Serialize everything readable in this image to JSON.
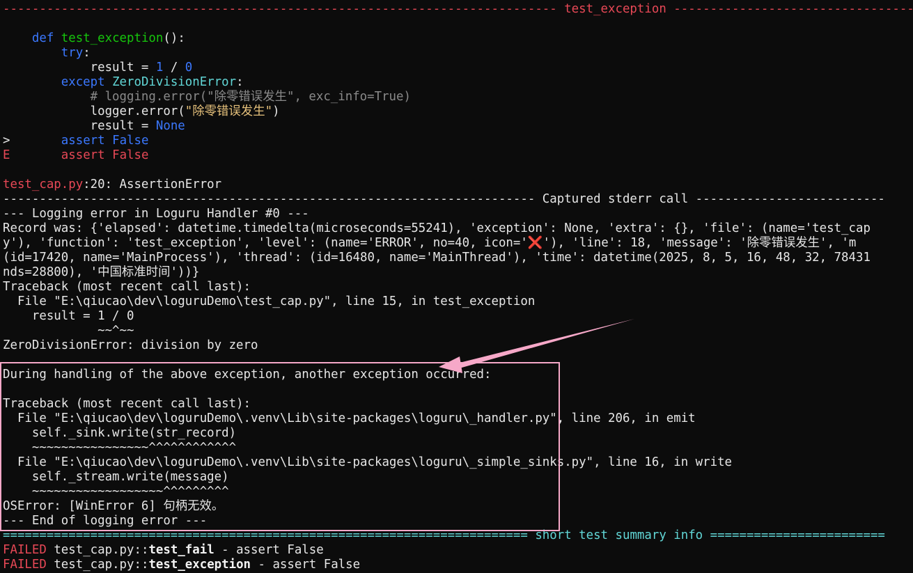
{
  "banner": {
    "left": "---------------------------------------------------------------------------- ",
    "title": "test_exception",
    "right": " -----------------------------------------"
  },
  "code": {
    "l1": {
      "indent": "    ",
      "kw": "def",
      "sp": " ",
      "fn": "test_exception",
      "rest": "():"
    },
    "l2": {
      "indent": "        ",
      "kw": "try",
      "rest": ":"
    },
    "l3": {
      "indent": "            ",
      "a": "result = ",
      "n1": "1",
      "op": " / ",
      "n2": "0"
    },
    "l4": {
      "indent": "        ",
      "kw": "except",
      "sp": " ",
      "cls": "ZeroDivisionError",
      "rest": ":"
    },
    "l5": {
      "indent": "            ",
      "text": "# logging.error(\"除零错误发生\", exc_info=True)"
    },
    "l6": {
      "indent": "            ",
      "a": "logger.error(",
      "str": "\"除零错误发生\"",
      "b": ")"
    },
    "l7": {
      "indent": "            ",
      "a": "result = ",
      "kw": "None"
    },
    "l8": {
      "prefix": ">",
      "indent": "       ",
      "kw": "assert",
      "sp": " ",
      "val": "False"
    },
    "l9": {
      "prefix": "E",
      "indent": "       ",
      "kw": "assert",
      "sp": " ",
      "val": "False"
    }
  },
  "location": {
    "file": "test_cap.py",
    "rest": ":20: AssertionError"
  },
  "stderr_banner": {
    "left": "------------------------------------------------------------------------- ",
    "title": "Captured stderr call",
    "right": " --------------------------"
  },
  "stderr_lines": [
    "--- Logging error in Loguru Handler #0 ---",
    "Record was: {'elapsed': datetime.timedelta(microseconds=55241), 'exception': None, 'extra': {}, 'file': (name='test_cap",
    "y'), 'function': 'test_exception', 'level': (name='ERROR', no=40, icon='",
    "(id=17420, name='MainProcess'), 'thread': (id=16480, name='MainThread'), 'time': datetime(2025, 8, 5, 16, 48, 32, 78431",
    "nds=28800), '中国标准时间'))}",
    "Traceback (most recent call last):",
    "  File \"E:\\qiucao\\dev\\loguruDemo\\test_cap.py\", line 15, in test_exception",
    "    result = 1 / 0",
    "             ~~^~~",
    "ZeroDivisionError: division by zero",
    "",
    "During handling of the above exception, another exception occurred:",
    "",
    "Traceback (most recent call last):",
    "  File \"E:\\qiucao\\dev\\loguruDemo\\.venv\\Lib\\site-packages\\loguru\\_handler.py\", line 206, in emit",
    "    self._sink.write(str_record)",
    "    ~~~~~~~~~~~~~~~~^^^^^^^^^^^^",
    "  File \"E:\\qiucao\\dev\\loguruDemo\\.venv\\Lib\\site-packages\\loguru\\_simple_sinks.py\", line 16, in write",
    "    self._stream.write(message)",
    "    ~~~~~~~~~~~~~~~~~~^^^^^^^^^",
    "OSError: [WinError 6] 句柄无效。",
    "--- End of logging error ---"
  ],
  "stderr_line3_icon": "❌",
  "stderr_line3_rest": "'), 'line': 18, 'message': '除零错误发生', 'm",
  "summary_banner": {
    "left": "======================================================================== ",
    "title": "short test summary info",
    "right": " ========================"
  },
  "summary": [
    {
      "status": "FAILED",
      "sep": " ",
      "file": "test_cap.py::",
      "test": "test_fail",
      "msg": " - assert False"
    },
    {
      "status": "FAILED",
      "sep": " ",
      "file": "test_cap.py::",
      "test": "test_exception",
      "msg": " - assert False"
    }
  ],
  "colors": {
    "background": "#0c0c0c",
    "error_red": "#e74856",
    "keyword_blue": "#3b78ff",
    "function_green": "#16c60c",
    "banner_cyan": "#61d6d6",
    "highlight_pink": "#f6a8c8"
  }
}
